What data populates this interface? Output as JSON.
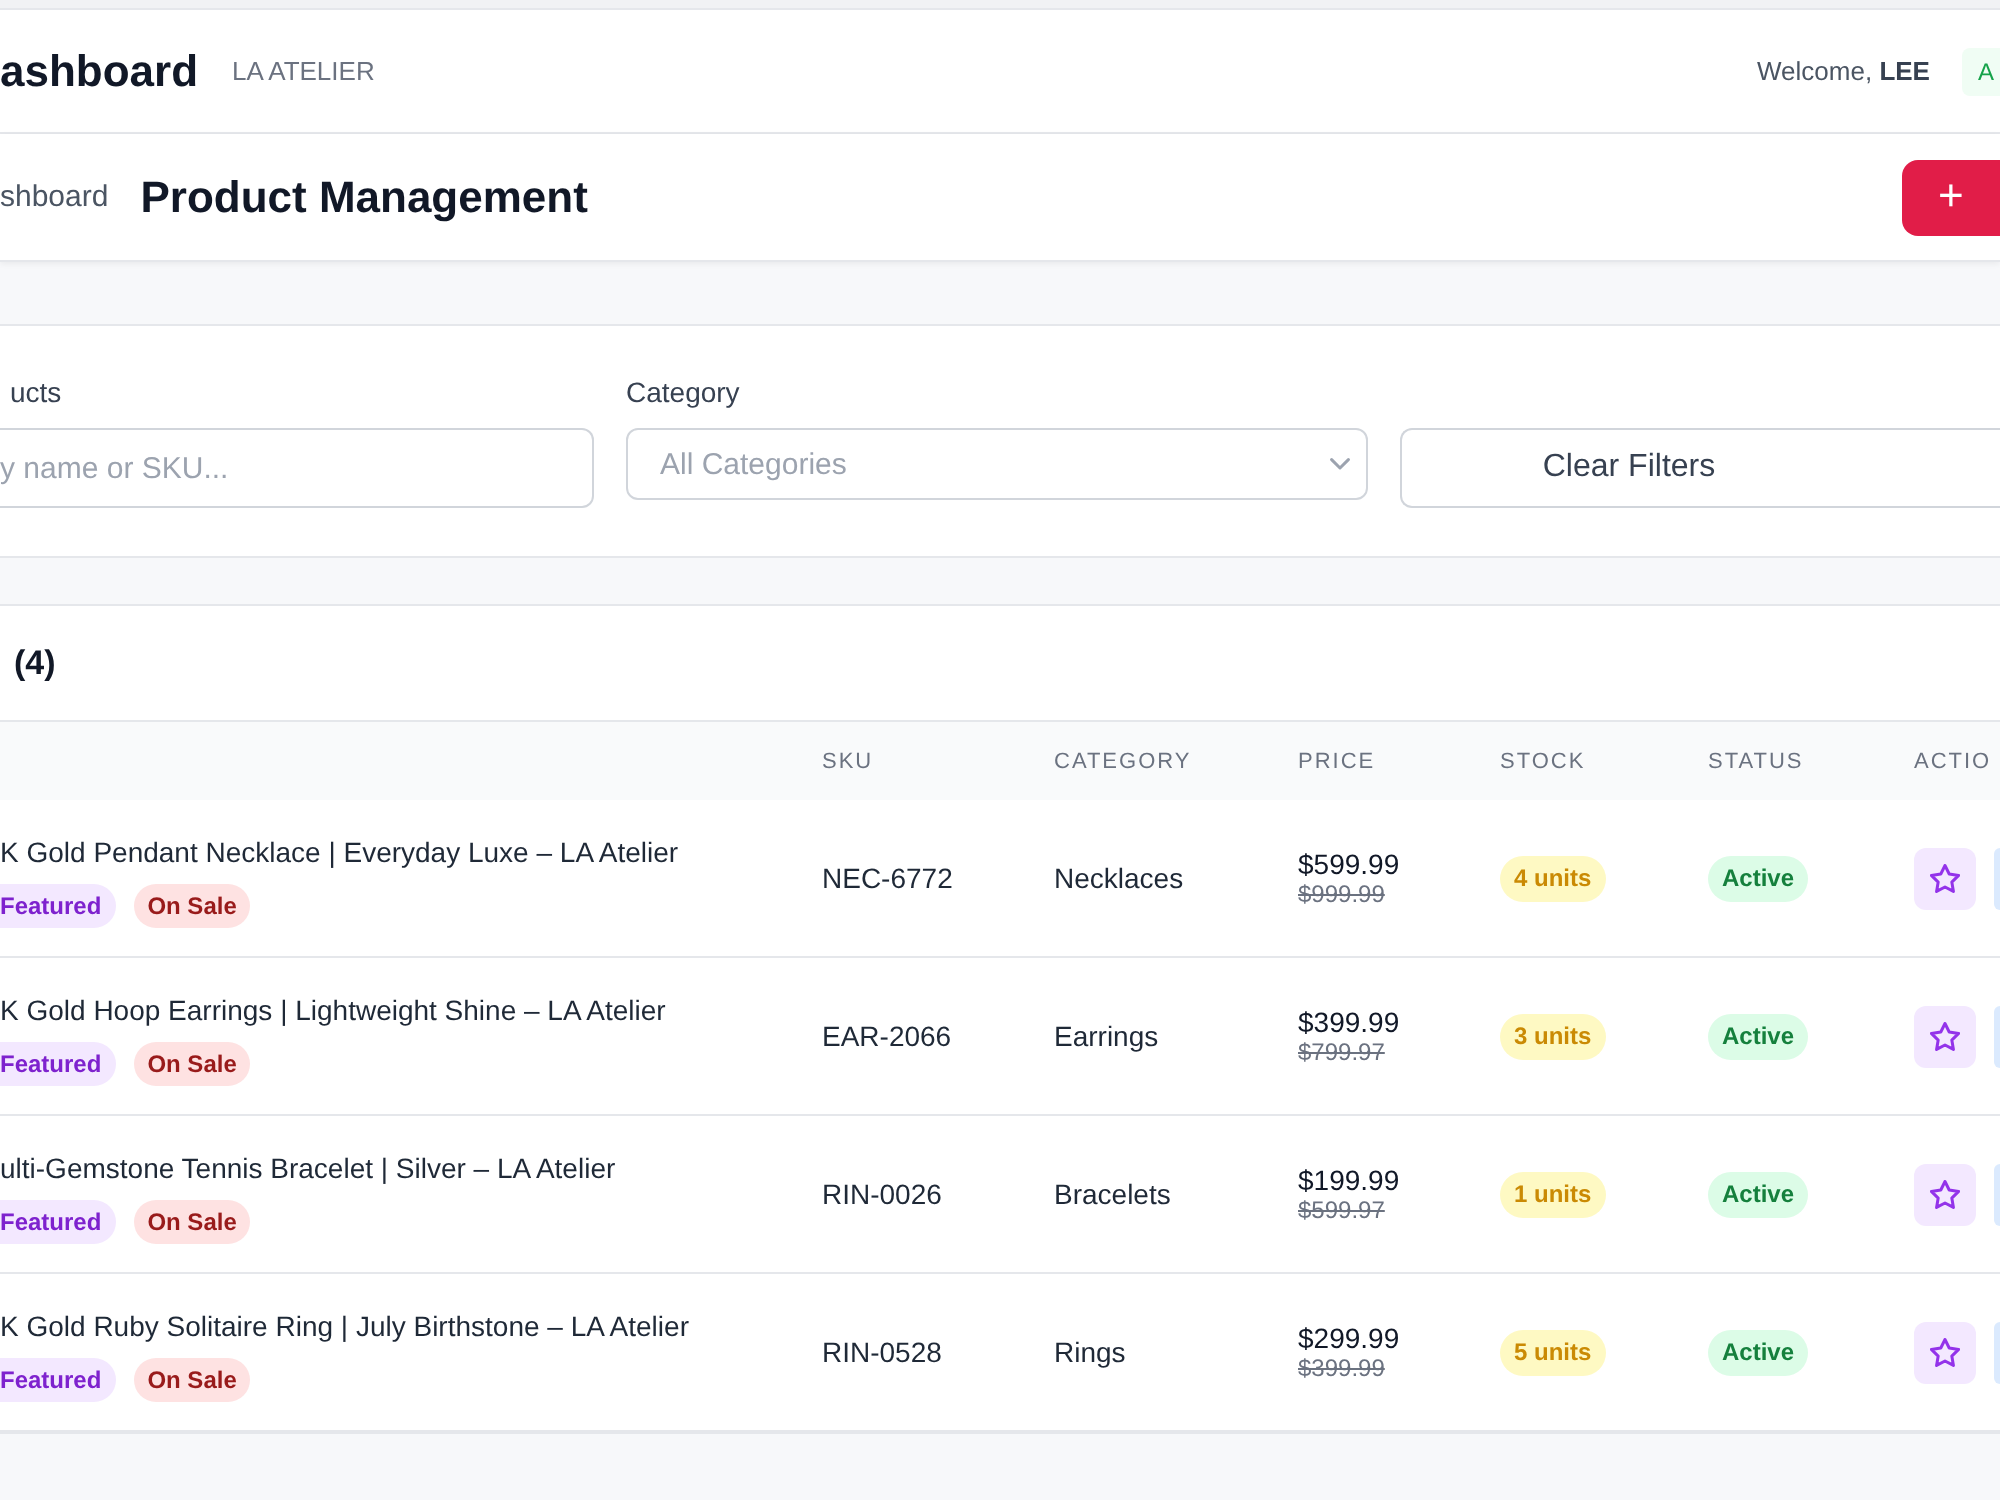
{
  "header": {
    "title": "ashboard",
    "brand": "LA ATELIER",
    "welcome": "Welcome, **LEE**",
    "badge": "A"
  },
  "page_bar": {
    "breadcrumb": "shboard",
    "title": "Product Management",
    "add_button": {
      "icon": "+"
    }
  },
  "filters": {
    "search": {
      "label": "ucts",
      "placeholder": "y name or SKU..."
    },
    "category": {
      "label": "Category",
      "placeholder": "All Categories"
    },
    "clear_button": "Clear Filters"
  },
  "products": {
    "title": "(4)",
    "columns": [
      "SKU",
      "CATEGORY",
      "PRICE",
      "STOCK",
      "STATUS",
      "ACTIO"
    ],
    "rows": [
      {
        "name": "K Gold Pendant Necklace | Everyday Luxe – LA Atelier",
        "tags": [
          {
            "kind": "featured",
            "label": "Featured"
          },
          {
            "kind": "sale",
            "label": "On Sale"
          }
        ],
        "sku": "NEC-6772",
        "category": "Necklaces",
        "price": "$599.99",
        "old_price": "$999.99",
        "stock": "4 units",
        "status": "Active"
      },
      {
        "name": "K Gold Hoop Earrings | Lightweight Shine – LA Atelier",
        "tags": [
          {
            "kind": "featured",
            "label": "Featured"
          },
          {
            "kind": "sale",
            "label": "On Sale"
          }
        ],
        "sku": "EAR-2066",
        "category": "Earrings",
        "price": "$399.99",
        "old_price": "$799.97",
        "stock": "3 units",
        "status": "Active"
      },
      {
        "name": "ulti-Gemstone Tennis Bracelet | Silver – LA Atelier",
        "tags": [
          {
            "kind": "featured",
            "label": "Featured"
          },
          {
            "kind": "sale",
            "label": "On Sale"
          }
        ],
        "sku": "RIN-0026",
        "category": "Bracelets",
        "price": "$199.99",
        "old_price": "$599.97",
        "stock": "1 units",
        "status": "Active"
      },
      {
        "name": "K Gold Ruby Solitaire Ring | July Birthstone – LA Atelier",
        "tags": [
          {
            "kind": "featured",
            "label": "Featured"
          },
          {
            "kind": "sale",
            "label": "On Sale"
          }
        ],
        "sku": "RIN-0528",
        "category": "Rings",
        "price": "$299.99",
        "old_price": "$399.99",
        "stock": "5 units",
        "status": "Active"
      }
    ]
  }
}
